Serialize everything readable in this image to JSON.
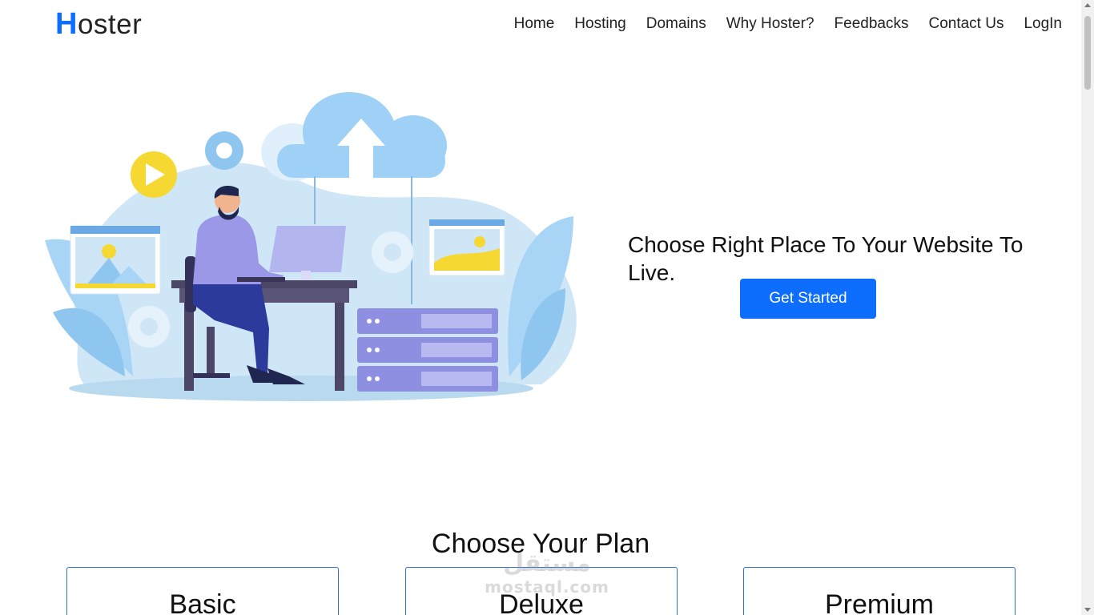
{
  "header": {
    "logo_initial": "H",
    "logo_rest": "oster",
    "nav": [
      "Home",
      "Hosting",
      "Domains",
      "Why Hoster?",
      "Feedbacks",
      "Contact Us",
      "LogIn"
    ]
  },
  "hero": {
    "headline": "Choose Right Place To Your Website To Live.",
    "cta_label": "Get Started",
    "illustration": "man-at-desk-cloud-hosting-illustration"
  },
  "plans": {
    "title": "Choose Your Plan",
    "cards": [
      "Basic",
      "Deluxe",
      "Premium"
    ]
  },
  "watermark": {
    "line1": "مستقل",
    "line2": "mostaql.com"
  },
  "colors": {
    "accent": "#0d6efd",
    "card_border": "#2f6fd6"
  }
}
